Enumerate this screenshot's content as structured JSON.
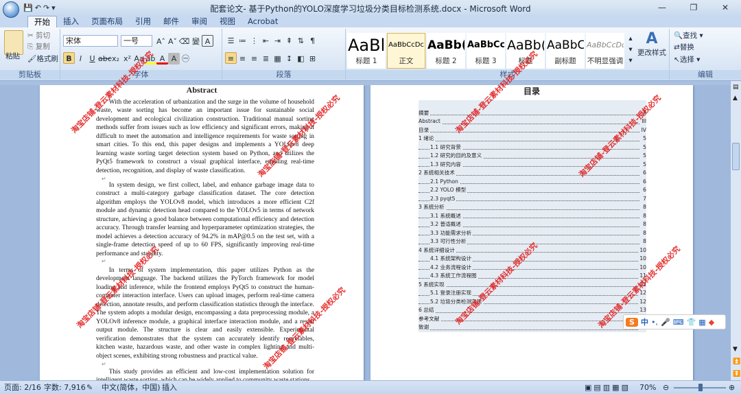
{
  "titlebar": {
    "title": "配套论文- 基于Python的YOLO深度学习垃圾分类目标检测系统.docx - Microsoft Word",
    "qa_icons": [
      "save-icon",
      "undo-icon",
      "redo-icon",
      "customize-icon"
    ],
    "win_buttons": [
      "—",
      "❐",
      "✕"
    ]
  },
  "tabs": [
    "开始",
    "插入",
    "页面布局",
    "引用",
    "邮件",
    "审阅",
    "视图",
    "Acrobat"
  ],
  "ribbon": {
    "clipboard": {
      "paste": "粘贴",
      "cut": "剪切",
      "copy": "复制",
      "format_painter": "格式刷",
      "label": "剪贴板"
    },
    "font": {
      "font_name": "宋体",
      "font_size": "一号",
      "label": "字体"
    },
    "paragraph": {
      "label": "段落"
    },
    "styles": {
      "items": [
        {
          "preview": "AaBl",
          "name": "标题 1"
        },
        {
          "preview": "AaBbCcDc",
          "name": "正文"
        },
        {
          "preview": "AaBb(",
          "name": "标题 2"
        },
        {
          "preview": "AaBbCc",
          "name": "标题 3"
        },
        {
          "preview": "AaBb(",
          "name": "标题"
        },
        {
          "preview": "AaBbC",
          "name": "副标题"
        },
        {
          "preview": "AaBbCcDc",
          "name": "不明显强调"
        }
      ],
      "change": "更改样式",
      "label": "样式"
    },
    "editing": {
      "find": "查找",
      "replace": "替换",
      "select": "选择",
      "label": "编辑"
    }
  },
  "left_page": {
    "title": "Abstract",
    "paragraphs": [
      "With the acceleration of urbanization and the surge in the volume of household waste, waste sorting has become an important issue for sustainable social development and ecological civilization construction. Traditional manual sorting methods suffer from issues such as low efficiency and significant errors, making it difficult to meet the automation and intelligence requirements for waste sorting in smart cities. To this end, this paper designs and implements a YOLOv8 deep learning waste sorting target detection system based on Python, and utilizes the PyQt5 framework to construct a visual graphical interface, enabling real-time detection, recognition, and display of waste classification.",
      "In system design, we first collect, label, and enhance garbage image data to construct a multi-category garbage classification dataset. The core detection algorithm employs the YOLOv8 model, which introduces a more efficient C2f module and dynamic detection head compared to the YOLOv5 in terms of network structure, achieving a good balance between computational efficiency and detection accuracy. Through transfer learning and hyperparameter optimization strategies, the model achieves a detection accuracy of 94.2% in mAP@0.5 on the test set, with a single-frame detection speed of up to 60 FPS, significantly improving real-time performance and stability.",
      "In terms of system implementation, this paper utilizes Python as the development language. The backend utilizes the PyTorch framework for model loading and inference, while the frontend employs PyQt5 to construct the human-computer interaction interface. Users can upload images, perform real-time camera detection, annotate results, and perform classification statistics through the interface. The system adopts a modular design, encompassing a data preprocessing module, a YOLOv8 inference module, a graphical interface interaction module, and a result output module. The structure is clear and easily extensible. Experimental verification demonstrates that the system can accurately identify recyclables, kitchen waste, hazardous waste, and other waste in complex lighting and multi-object scenes, exhibiting strong robustness and practical value.",
      "This study provides an efficient and low-cost implementation solution for intelligent waste sorting, which can be widely applied to community waste stations"
    ]
  },
  "right_page": {
    "title": "目录",
    "toc": [
      {
        "text": "摘要",
        "page": "II",
        "level": 1
      },
      {
        "text": "Abstract",
        "page": "III",
        "level": 1
      },
      {
        "text": "目录",
        "page": "IV",
        "level": 1
      },
      {
        "text": "1 绪论",
        "page": "5",
        "level": 1
      },
      {
        "text": "1.1 研究背景",
        "page": "5",
        "level": 2
      },
      {
        "text": "1.2 研究的目的及意义",
        "page": "5",
        "level": 2
      },
      {
        "text": "1.3 研究内容",
        "page": "5",
        "level": 2
      },
      {
        "text": "2 系统相关技术",
        "page": "6",
        "level": 1
      },
      {
        "text": "2.1 Python",
        "page": "6",
        "level": 2
      },
      {
        "text": "2.2 YOLO 模型",
        "page": "6",
        "level": 2
      },
      {
        "text": "2.3 pyqt5",
        "page": "7",
        "level": 2
      },
      {
        "text": "3 系统分析",
        "page": "8",
        "level": 1
      },
      {
        "text": "3.1 系统概述",
        "page": "8",
        "level": 2
      },
      {
        "text": "3.2 普适概述",
        "page": "8",
        "level": 2
      },
      {
        "text": "3.3 功能需求分析",
        "page": "8",
        "level": 2
      },
      {
        "text": "3.3 可行性分析",
        "page": "8",
        "level": 2
      },
      {
        "text": "4 系统详细设计",
        "page": "10",
        "level": 1
      },
      {
        "text": "4.1 系统架构设计",
        "page": "10",
        "level": 2
      },
      {
        "text": "4.2 业务流程设计",
        "page": "10",
        "level": 2
      },
      {
        "text": "4.3 系统工作流程图",
        "page": "11",
        "level": 2
      },
      {
        "text": "5 系统实现",
        "page": "12",
        "level": 1
      },
      {
        "text": "5.1 登录注册实现",
        "page": "12",
        "level": 2
      },
      {
        "text": "5.2 垃圾分类检测实现",
        "page": "12",
        "level": 2
      },
      {
        "text": "6 总结",
        "page": "13",
        "level": 1
      },
      {
        "text": "参考文献",
        "page": "14",
        "level": 1
      },
      {
        "text": "致谢",
        "page": "15",
        "level": 1
      }
    ]
  },
  "watermark": "淘宝店铺-登云素材科技-授权必究",
  "ime": {
    "logo": "S",
    "mode": "中"
  },
  "statusbar": {
    "page": "页面: 2/16",
    "words": "字数: 7,916",
    "lang": "中文(简体，中国)",
    "mode": "插入",
    "zoom": "70%"
  }
}
